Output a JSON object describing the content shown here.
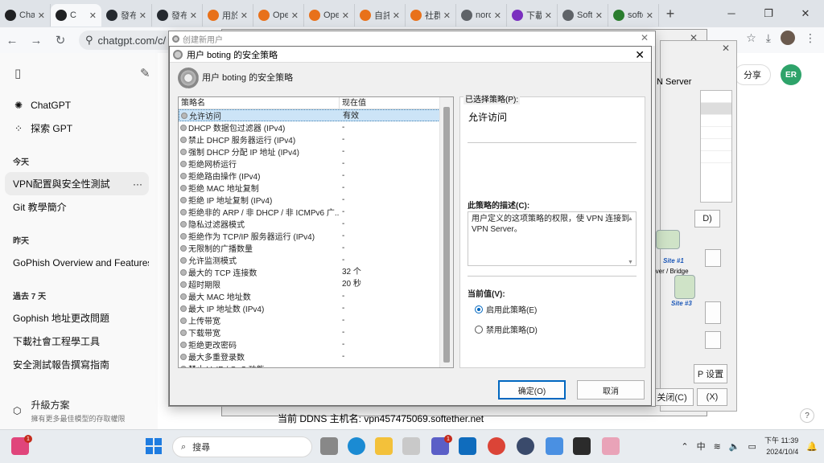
{
  "browser": {
    "tabs": [
      {
        "label": "ChatG",
        "color": "#202123"
      },
      {
        "label": "C",
        "color": "#202123"
      },
      {
        "label": "發布",
        "color": "#24292f"
      },
      {
        "label": "發布",
        "color": "#24292f"
      },
      {
        "label": "用於",
        "color": "#e8711a"
      },
      {
        "label": "Open",
        "color": "#e8711a"
      },
      {
        "label": "Open",
        "color": "#e8711a"
      },
      {
        "label": "自託",
        "color": "#e8711a"
      },
      {
        "label": "社群",
        "color": "#e8711a"
      },
      {
        "label": "nordv",
        "color": "#5f6368"
      },
      {
        "label": "下載",
        "color": "#7a2fbf"
      },
      {
        "label": "SoftE",
        "color": "#5f6368"
      },
      {
        "label": "softe",
        "color": "#2a7d2e"
      }
    ],
    "url": "chatgpt.com/c/"
  },
  "sidebar": {
    "items": [
      {
        "label": "ChatGPT"
      },
      {
        "label": "探索 GPT"
      }
    ],
    "sections": [
      {
        "title": "今天",
        "chats": [
          "VPN配置與安全性測試",
          "Git 教學簡介"
        ]
      },
      {
        "title": "昨天",
        "chats": [
          "GoPhish Overview and Features"
        ]
      },
      {
        "title": "過去 7 天",
        "chats": [
          "Gophish 地址更改問題",
          "下載社會工程學工具",
          "安全測試報告撰寫指南"
        ]
      }
    ],
    "upgrade": {
      "title": "升級方案",
      "subtitle": "擁有更多最佳模型的存取權限"
    }
  },
  "chat": {
    "share": "分享",
    "avatar": "ER"
  },
  "background_window": {
    "server_label": "N Server",
    "btn_d": "D)",
    "site1": "Site #1",
    "bridge": "rver / Bridge",
    "site3": "Site #3",
    "settings": "P 设置",
    "close": "关闭(C)",
    "x": "(X)",
    "ddns": "当前 DDNS 主机名: vpn457475069.softether.net"
  },
  "outer_dialog": {
    "title": "创建新用户"
  },
  "dialog": {
    "title": "用户 boting 的安全策略",
    "header": "用户 boting 的安全策略",
    "columns": [
      "策略名",
      "现在值"
    ],
    "rows": [
      {
        "name": "允许访问",
        "value": "有效"
      },
      {
        "name": "DHCP 数据包过滤器 (IPv4)",
        "value": "-"
      },
      {
        "name": "禁止 DHCP 服务器运行 (IPv4)",
        "value": "-"
      },
      {
        "name": "强制 DHCP 分配 IP 地址 (IPv4)",
        "value": "-"
      },
      {
        "name": "拒绝网桥运行",
        "value": "-"
      },
      {
        "name": "拒绝路由操作 (IPv4)",
        "value": "-"
      },
      {
        "name": "拒绝 MAC 地址复制",
        "value": "-"
      },
      {
        "name": "拒绝 IP 地址复制 (IPv4)",
        "value": "-"
      },
      {
        "name": "拒绝非的 ARP / 非 DHCP / 非 ICMPv6 广...",
        "value": "-"
      },
      {
        "name": "隐私过滤器模式",
        "value": "-"
      },
      {
        "name": "拒绝作为 TCP/IP 服务器运行 (IPv4)",
        "value": "-"
      },
      {
        "name": "无限制的广播数量",
        "value": "-"
      },
      {
        "name": "允许监测模式",
        "value": "-"
      },
      {
        "name": "最大的 TCP 连接数",
        "value": "32 个"
      },
      {
        "name": "超时期限",
        "value": "20 秒"
      },
      {
        "name": "最大 MAC 地址数",
        "value": "-"
      },
      {
        "name": "最大 IP 地址数 (IPv4)",
        "value": "-"
      },
      {
        "name": "上传带宽",
        "value": "-"
      },
      {
        "name": "下载带宽",
        "value": "-"
      },
      {
        "name": "拒绝更改密码",
        "value": "-"
      },
      {
        "name": "最大多重登录数",
        "value": "-"
      },
      {
        "name": "禁止 VoIP / QoS 功能",
        "value": "-"
      }
    ],
    "selected_label": "已选择策略(P):",
    "selected_value": "允许访问",
    "desc_label": "此策略的描述(C):",
    "desc_text": "用户定义的这项策略的权限，使 VPN 连接到 VPN Server。",
    "current_label": "当前值(V):",
    "radio_enable": "启用此策略(E)",
    "radio_disable": "禁用此策略(D)",
    "ok": "确定(O)",
    "cancel": "取消"
  },
  "taskbar": {
    "search": "搜尋",
    "ime": "中",
    "time": "下午 11:39",
    "date": "2024/10/4"
  }
}
